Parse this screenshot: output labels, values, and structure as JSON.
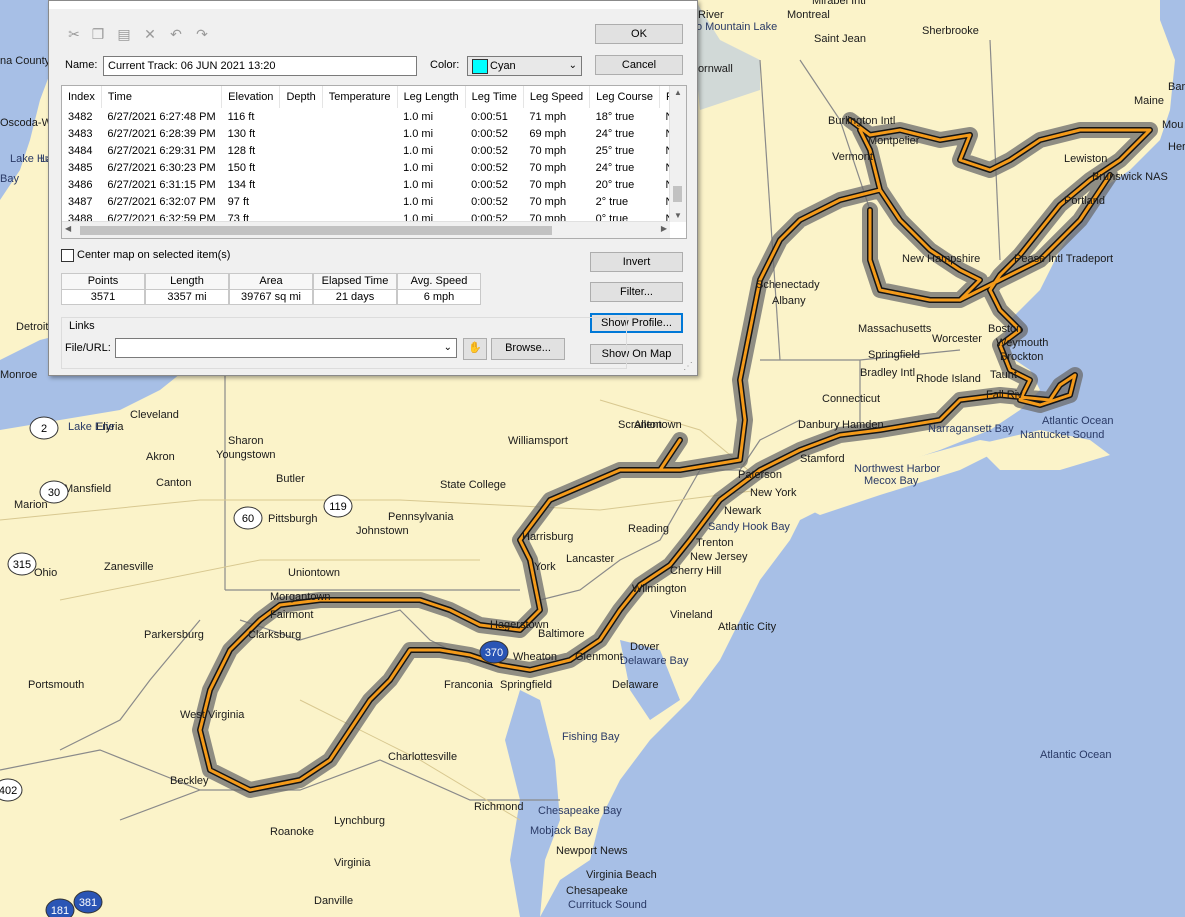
{
  "dialog": {
    "name_label": "Name:",
    "name_value": "Current Track: 06 JUN 2021 13:20",
    "color_label": "Color:",
    "color_value": "Cyan",
    "color_swatch": "#00ffff",
    "ok_label": "OK",
    "cancel_label": "Cancel",
    "toolbar_icons": [
      "cut-icon",
      "copy-icon",
      "paste-icon",
      "delete-icon",
      "undo-icon",
      "redo-icon"
    ],
    "columns": [
      "Index",
      "Time",
      "Elevation",
      "Depth",
      "Temperature",
      "Leg Length",
      "Leg Time",
      "Leg Speed",
      "Leg Course",
      "Po"
    ],
    "rows": [
      [
        "3482",
        "6/27/2021 6:27:48 PM",
        "116 ft",
        "",
        "",
        "1.0 mi",
        "0:00:51",
        "71 mph",
        "18° true",
        "N"
      ],
      [
        "3483",
        "6/27/2021 6:28:39 PM",
        "130 ft",
        "",
        "",
        "1.0 mi",
        "0:00:52",
        "69 mph",
        "24° true",
        "N"
      ],
      [
        "3484",
        "6/27/2021 6:29:31 PM",
        "128 ft",
        "",
        "",
        "1.0 mi",
        "0:00:52",
        "70 mph",
        "25° true",
        "N"
      ],
      [
        "3485",
        "6/27/2021 6:30:23 PM",
        "150 ft",
        "",
        "",
        "1.0 mi",
        "0:00:52",
        "70 mph",
        "24° true",
        "N"
      ],
      [
        "3486",
        "6/27/2021 6:31:15 PM",
        "134 ft",
        "",
        "",
        "1.0 mi",
        "0:00:52",
        "70 mph",
        "20° true",
        "N"
      ],
      [
        "3487",
        "6/27/2021 6:32:07 PM",
        "97 ft",
        "",
        "",
        "1.0 mi",
        "0:00:52",
        "70 mph",
        "2° true",
        "N"
      ],
      [
        "3488",
        "6/27/2021 6:32:59 PM",
        "73 ft",
        "",
        "",
        "1.0 mi",
        "0:00:52",
        "70 mph",
        "0° true",
        "N"
      ]
    ],
    "center_map_label": "Center map on selected item(s)",
    "stats": {
      "headers": [
        "Points",
        "Length",
        "Area",
        "Elapsed Time",
        "Avg. Speed"
      ],
      "values": [
        "3571",
        "3357 mi",
        "39767 sq mi",
        "21 days",
        "6 mph"
      ]
    },
    "invert_label": "Invert",
    "filter_label": "Filter...",
    "show_profile_label": "Show Profile...",
    "show_on_map_label": "Show On Map",
    "links_label": "Links",
    "file_url_label": "File/URL:",
    "file_url_value": "",
    "browse_label": "Browse..."
  },
  "map": {
    "colors": {
      "land": "#fbf3c9",
      "water": "#a7bfe6",
      "track": "#f39a1a"
    },
    "places": [
      "River",
      "Montreal",
      "Mirabel Intl",
      "wo Mountain Lake",
      "Saint Jean",
      "Sherbrooke",
      "Cornwall",
      "Burlington Intl",
      "Montpelier",
      "Vermont",
      "Maine",
      "Lewiston",
      "Brunswick NAS",
      "Portland",
      "Mou",
      "Her",
      "Bar",
      "New Hampshire",
      "Pease Intl Tradeport",
      "Schenectady",
      "Albany",
      "Massachusetts",
      "Worcester",
      "Boston",
      "Weymouth",
      "Brockton",
      "Springfield",
      "Bradley Intl",
      "Rhode Island",
      "Taunt",
      "Fall Riv",
      "Connecticut",
      "Hamden",
      "Danbury",
      "Stamford",
      "Narragansett Bay",
      "Atlantic Ocean",
      "Nantucket Sound",
      "Northwest Harbor",
      "Mecox Bay",
      "Paterson",
      "New York",
      "Newark",
      "Sandy Hook Bay",
      "Trenton",
      "New Jersey",
      "Cherry Hill",
      "Wilmington",
      "Vineland",
      "Atlantic City",
      "Dover",
      "Delaware Bay",
      "Delaware",
      "Allentown",
      "Reading",
      "Lancaster",
      "Harrisburg",
      "York",
      "Scranton",
      "Williamsport",
      "State College",
      "Pennsylvania",
      "Johnstown",
      "Pittsburgh",
      "Butler",
      "Youngstown",
      "Sharon",
      "Cleveland",
      "Elyria",
      "Lake Erie",
      "Akron",
      "Canton",
      "Mansfield",
      "Marion",
      "Zanesville",
      "Ohio",
      "Uniontown",
      "Morgantown",
      "Fairmont",
      "Clarksburg",
      "Parkersburg",
      "Portsmouth",
      "West Virginia",
      "Beckley",
      "Charlottesville",
      "Lynchburg",
      "Roanoke",
      "Virginia",
      "Danville",
      "Richmond",
      "Chesapeake Bay",
      "Mobjack Bay",
      "Newport News",
      "Virginia Beach",
      "Chesapeake",
      "Currituck Sound",
      "Fishing Bay",
      "Baltimore",
      "Glenmont",
      "Wheaton",
      "Franconia",
      "Springfield",
      "Hagerstown",
      "Oscoda-Wurtsmith",
      "Lake Huron",
      "Detroit",
      "Monroe",
      "Bay",
      "Lake Hu",
      "na County",
      "Atlantic Ocean"
    ],
    "route_shields": [
      "2",
      "30",
      "60",
      "119",
      "315",
      "370",
      "381",
      "181",
      "402"
    ]
  }
}
